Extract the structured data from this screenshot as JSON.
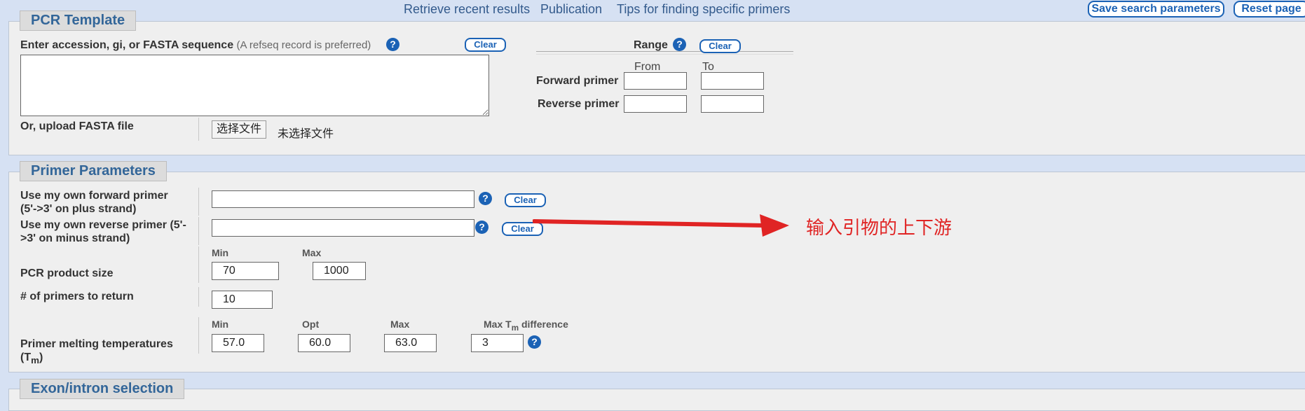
{
  "top_links": [
    "Retrieve recent results",
    "Publication",
    "Tips for finding specific primers"
  ],
  "top_buttons": {
    "save": "Save search parameters",
    "reset": "Reset page"
  },
  "pcr_template": {
    "title": "PCR Template",
    "seq_label": "Enter accession, gi, or FASTA sequence",
    "seq_note": "(A refseq record is preferred)",
    "seq_value": "",
    "clear": "Clear",
    "upload_label": "Or, upload FASTA file",
    "file_button": "选择文件",
    "file_status": "未选择文件",
    "range": {
      "title": "Range",
      "clear": "Clear",
      "from": "From",
      "to": "To",
      "forward_label": "Forward primer",
      "reverse_label": "Reverse primer",
      "forward_from": "",
      "forward_to": "",
      "reverse_from": "",
      "reverse_to": ""
    }
  },
  "primer_params": {
    "title": "Primer Parameters",
    "forward_label_1": "Use my own forward primer",
    "forward_label_2": "(5'->3' on plus strand)",
    "forward_value": "",
    "reverse_label_1": "Use my own reverse primer (5'-",
    "reverse_label_2": ">3' on minus strand)",
    "reverse_value": "",
    "clear": "Clear",
    "product_size": {
      "label": "PCR product size",
      "min_label": "Min",
      "max_label": "Max",
      "min": "70",
      "max": "1000"
    },
    "num_primers": {
      "label": "# of primers to return",
      "value": "10"
    },
    "tm": {
      "label_1": "Primer melting temperatures",
      "label_2_main": "(T",
      "label_2_sub": "m",
      "label_2_end": ")",
      "min_label": "Min",
      "opt_label": "Opt",
      "max_label": "Max",
      "diff_label_a": "Max T",
      "diff_label_sub": "m",
      "diff_label_b": " difference",
      "min": "57.0",
      "opt": "60.0",
      "max": "63.0",
      "diff": "3"
    }
  },
  "annotation": "输入引物的上下游",
  "next_section": {
    "title": "Exon/intron selection"
  },
  "colors": {
    "accent": "#1b62b5",
    "annotation": "#e02424",
    "title": "#336699"
  }
}
